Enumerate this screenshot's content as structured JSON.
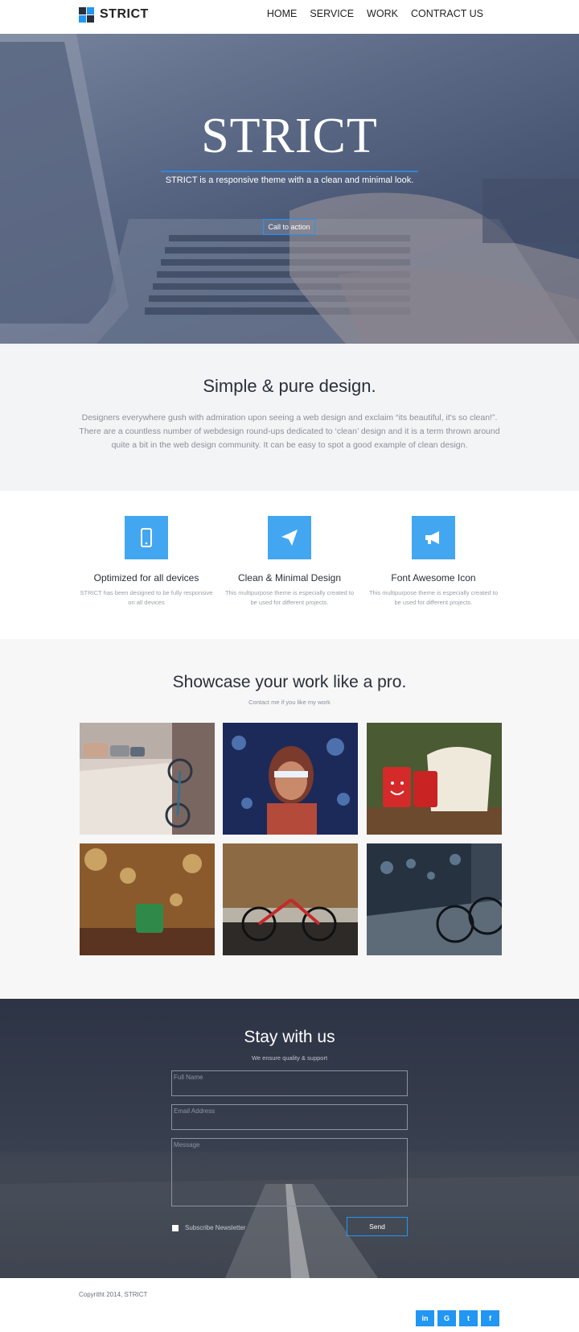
{
  "brand": {
    "name": "STRICT",
    "colors": {
      "accent": "#2196f3",
      "dark": "#2a2f3a"
    }
  },
  "nav": {
    "items": [
      "HOME",
      "SERVICE",
      "WORK",
      "CONTRACT US"
    ]
  },
  "hero": {
    "title": "STRICT",
    "subtitle": "STRICT is a responsive theme with a a clean and minimal look.",
    "cta": "Call to action"
  },
  "intro": {
    "heading": "Simple & pure design.",
    "body": "Designers everywhere gush with admiration upon seeing a web design and exclaim “its beautiful, it's so clean!”. There are a countless number of webdesign round-ups dedicated to ‘clean’ design and it is a term thrown around quite a bit in the web design community. It can be easy to spot a good example of clean design."
  },
  "features": [
    {
      "icon": "mobile-icon",
      "title": "Optimized for all devices",
      "text": "STRICT has been designed to be fully responsive on all devices"
    },
    {
      "icon": "paper-plane-icon",
      "title": "Clean & Minimal Design",
      "text": "This multipurpose theme is especially created to be used for different projects."
    },
    {
      "icon": "megaphone-icon",
      "title": "Font Awesome Icon",
      "text": "This multipurpose theme is especially created to be used for different projects."
    }
  ],
  "showcase": {
    "heading": "Showcase your work like a pro.",
    "subheading": "Contact me if you like my work"
  },
  "contact": {
    "heading": "Stay with us",
    "subheading": "We ensure quality & support",
    "full_name_placeholder": "Full Name",
    "email_placeholder": "Email Address",
    "message_placeholder": "Message",
    "subscribe_label": "Subscribe Newsletter",
    "send_label": "Send"
  },
  "footer": {
    "copyright": "Copyritht 2014, STRICT",
    "social": [
      "in",
      "G",
      "t",
      "f"
    ]
  }
}
